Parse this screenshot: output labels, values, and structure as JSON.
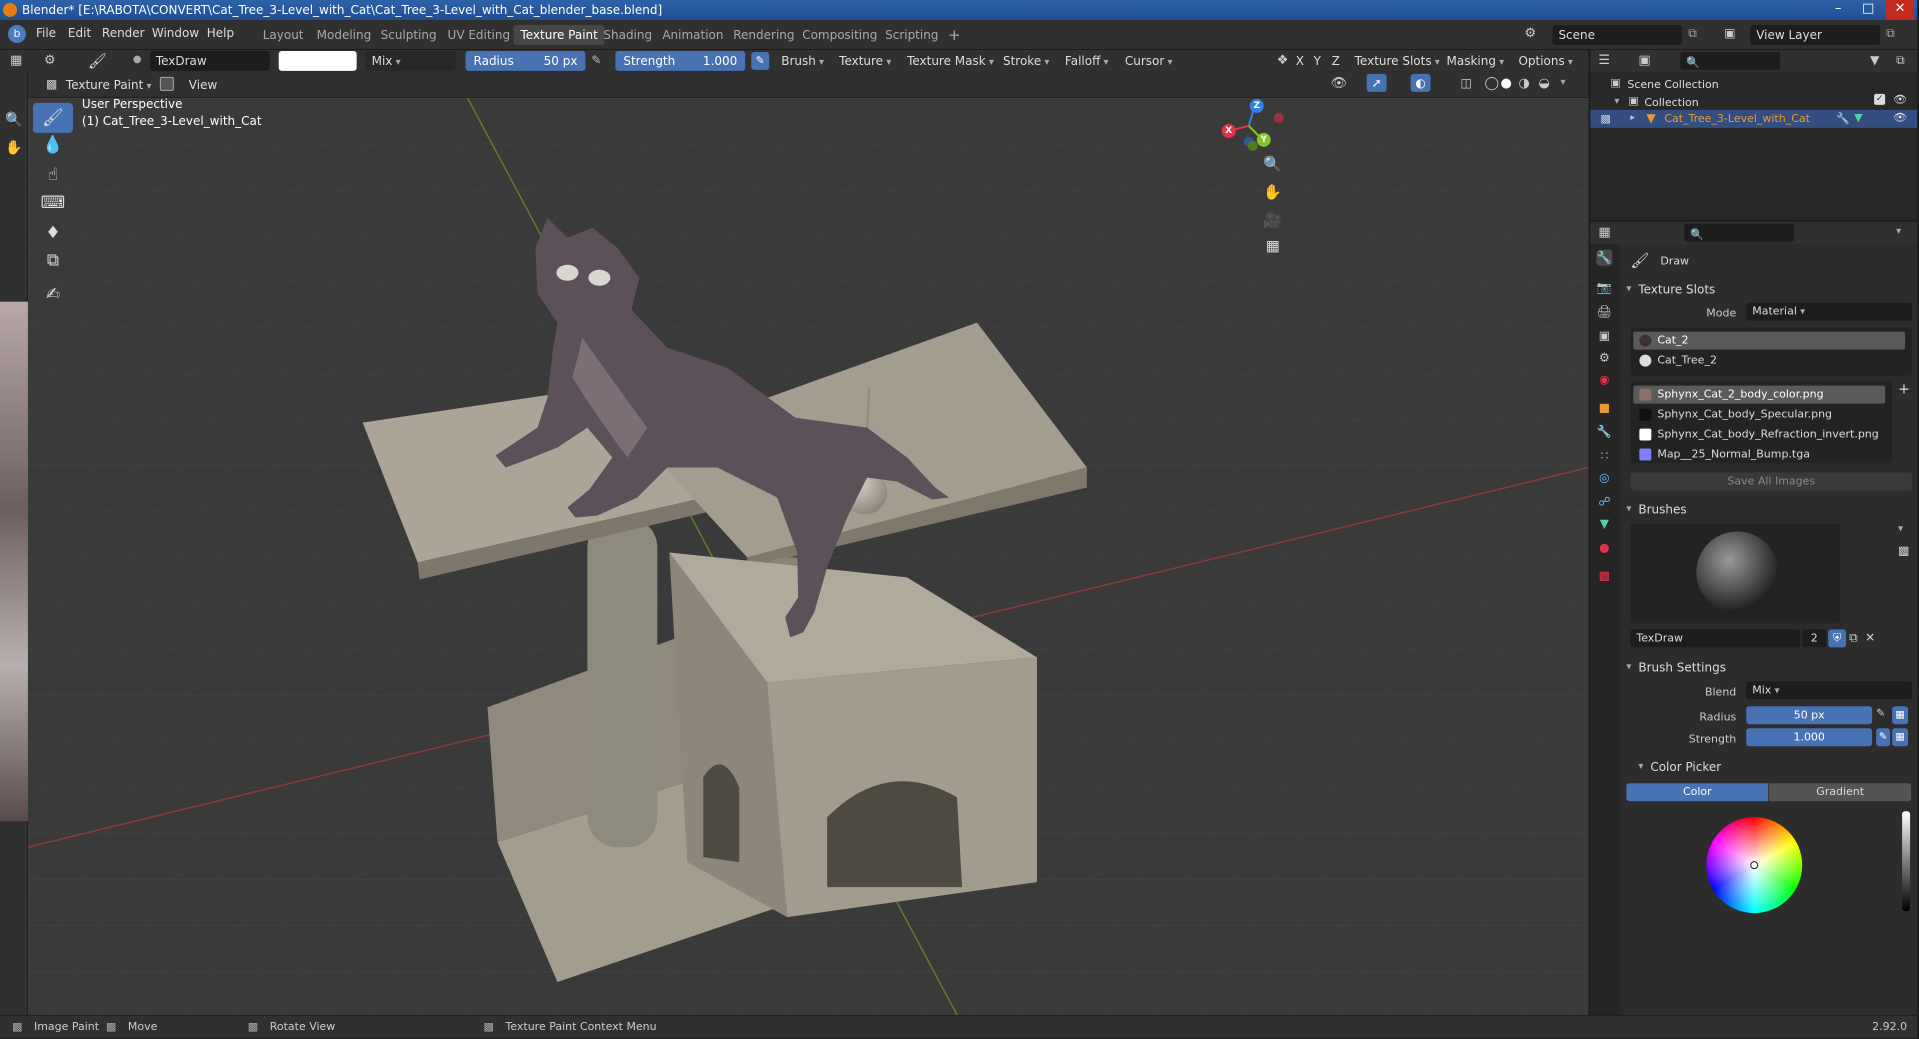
{
  "window": {
    "title": "Blender* [E:\\RABOTA\\CONVERT\\Cat_Tree_3-Level_with_Cat\\Cat_Tree_3-Level_with_Cat_blender_base.blend]"
  },
  "menu": {
    "items": [
      "File",
      "Edit",
      "Render",
      "Window",
      "Help"
    ]
  },
  "workspaces": {
    "tabs": [
      "Layout",
      "Modeling",
      "Sculpting",
      "UV Editing",
      "Texture Paint",
      "Shading",
      "Animation",
      "Rendering",
      "Compositing",
      "Scripting"
    ],
    "active": "Texture Paint",
    "add": "+"
  },
  "scene": {
    "label": "Scene",
    "view_layer": "View Layer"
  },
  "header": {
    "brush_name": "TexDraw",
    "blend": "Mix",
    "radius_label": "Radius",
    "radius_value": "50 px",
    "strength_label": "Strength",
    "strength_value": "1.000",
    "menus": [
      "Brush",
      "Texture",
      "Texture Mask",
      "Stroke",
      "Falloff",
      "Cursor"
    ],
    "axes": [
      "X",
      "Y",
      "Z"
    ],
    "right_menus": [
      "Texture Slots",
      "Masking",
      "Options"
    ]
  },
  "subheader": {
    "mode": "Texture Paint",
    "view": "View"
  },
  "viewport": {
    "perspective": "User Perspective",
    "object": "(1) Cat_Tree_3-Level_with_Cat",
    "gizmo": {
      "x": "X",
      "y": "Y",
      "z": "Z"
    }
  },
  "outliner": {
    "scene_collection": "Scene Collection",
    "collection": "Collection",
    "object": "Cat_Tree_3-Level_with_Cat"
  },
  "properties": {
    "tool_name": "Draw",
    "texture_slots": {
      "title": "Texture Slots",
      "mode_label": "Mode",
      "mode_value": "Material",
      "materials": [
        "Cat_2",
        "Cat_Tree_2"
      ],
      "images": [
        "Sphynx_Cat_2_body_color.png",
        "Sphynx_Cat_body_Specular.png",
        "Sphynx_Cat_body_Refraction_invert.png",
        "Map__25_Normal_Bump.tga"
      ],
      "save_all": "Save All Images"
    },
    "brushes": {
      "title": "Brushes",
      "brush_name": "TexDraw",
      "users": "2"
    },
    "brush_settings": {
      "title": "Brush Settings",
      "blend_label": "Blend",
      "blend_value": "Mix",
      "radius_label": "Radius",
      "radius_value": "50 px",
      "strength_label": "Strength",
      "strength_value": "1.000"
    },
    "color_picker": {
      "title": "Color Picker",
      "tab_color": "Color",
      "tab_gradient": "Gradient"
    }
  },
  "status": {
    "image_paint": "Image Paint",
    "move": "Move",
    "rotate": "Rotate View",
    "context": "Texture Paint Context Menu",
    "version": "2.92.0"
  },
  "colors": {
    "accent": "#4772b3",
    "active_object": "#e79a32",
    "axis_x": "#e2334b",
    "axis_y": "#82c425",
    "axis_z": "#2f83e3"
  }
}
